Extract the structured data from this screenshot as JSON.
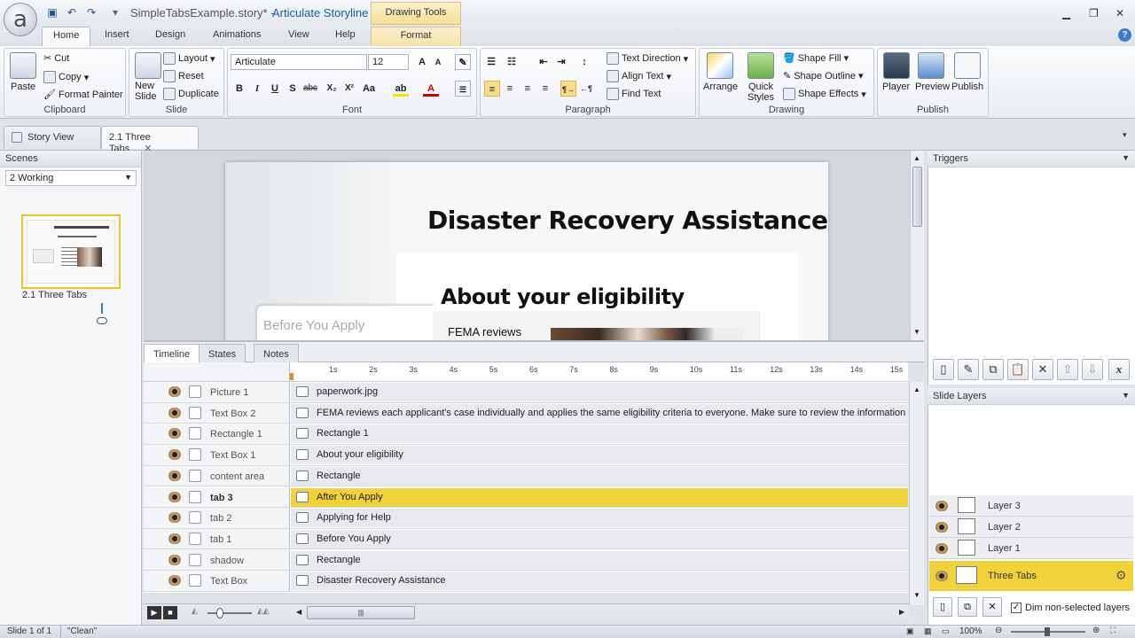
{
  "titlebar": {
    "document": "SimpleTabsExample.story* -",
    "app": "Articulate Storyline",
    "contextual_tab": "Drawing Tools"
  },
  "ribbon_tabs": [
    "Home",
    "Insert",
    "Design",
    "Animations",
    "View",
    "Help"
  ],
  "format_tab": "Format",
  "ribbon": {
    "clipboard": {
      "label": "Clipboard",
      "paste": "Paste",
      "cut": "Cut",
      "copy": "Copy",
      "format_painter": "Format Painter"
    },
    "slide": {
      "label": "Slide",
      "new_slide": "New Slide",
      "layout": "Layout",
      "reset": "Reset",
      "duplicate": "Duplicate"
    },
    "font": {
      "label": "Font",
      "family": "Articulate",
      "size": "12"
    },
    "paragraph": {
      "label": "Paragraph",
      "text_direction": "Text Direction",
      "align_text": "Align Text",
      "find_text": "Find Text"
    },
    "drawing": {
      "label": "Drawing",
      "arrange": "Arrange",
      "quick_styles": "Quick Styles",
      "shape_fill": "Shape Fill",
      "shape_outline": "Shape Outline",
      "shape_effects": "Shape Effects"
    },
    "publish": {
      "label": "Publish",
      "player": "Player",
      "preview": "Preview",
      "publish": "Publish"
    }
  },
  "doc_tabs": [
    "Story View",
    "2.1 Three Tabs"
  ],
  "scenes": {
    "header": "Scenes",
    "selected": "2 Working",
    "thumb_label": "2.1 Three Tabs"
  },
  "slide": {
    "title": "Disaster Recovery Assistance",
    "heading": "About your eligibility",
    "tab_label": "Before You Apply",
    "body_start": "FEMA reviews"
  },
  "timeline": {
    "tabs": [
      "Timeline",
      "States",
      "Notes"
    ],
    "ticks": [
      "1s",
      "2s",
      "3s",
      "4s",
      "5s",
      "6s",
      "7s",
      "8s",
      "9s",
      "10s",
      "11s",
      "12s",
      "13s",
      "14s",
      "15s"
    ],
    "rows": [
      {
        "name": "Picture 1",
        "content": "paperwork.jpg"
      },
      {
        "name": "Text Box 2",
        "content": "FEMA reviews each applicant's case individually and applies the same eligibility criteria to everyone.   Make sure to review the information about wha"
      },
      {
        "name": "Rectangle 1",
        "content": "Rectangle 1"
      },
      {
        "name": "Text Box 1",
        "content": "About your eligibility"
      },
      {
        "name": "content area",
        "content": "Rectangle"
      },
      {
        "name": "tab 3",
        "content": "After You Apply"
      },
      {
        "name": "tab 2",
        "content": "Applying for Help"
      },
      {
        "name": "tab 1",
        "content": "Before You Apply"
      },
      {
        "name": "shadow",
        "content": "Rectangle"
      },
      {
        "name": "Text Box",
        "content": "Disaster Recovery Assistance"
      }
    ]
  },
  "triggers": {
    "header": "Triggers"
  },
  "layers": {
    "header": "Slide Layers",
    "items": [
      "Layer 3",
      "Layer 2",
      "Layer 1"
    ],
    "base": "Three Tabs",
    "dim_label": "Dim non-selected layers"
  },
  "status": {
    "slide": "Slide 1 of 1",
    "theme": "\"Clean\"",
    "zoom": "100%"
  }
}
